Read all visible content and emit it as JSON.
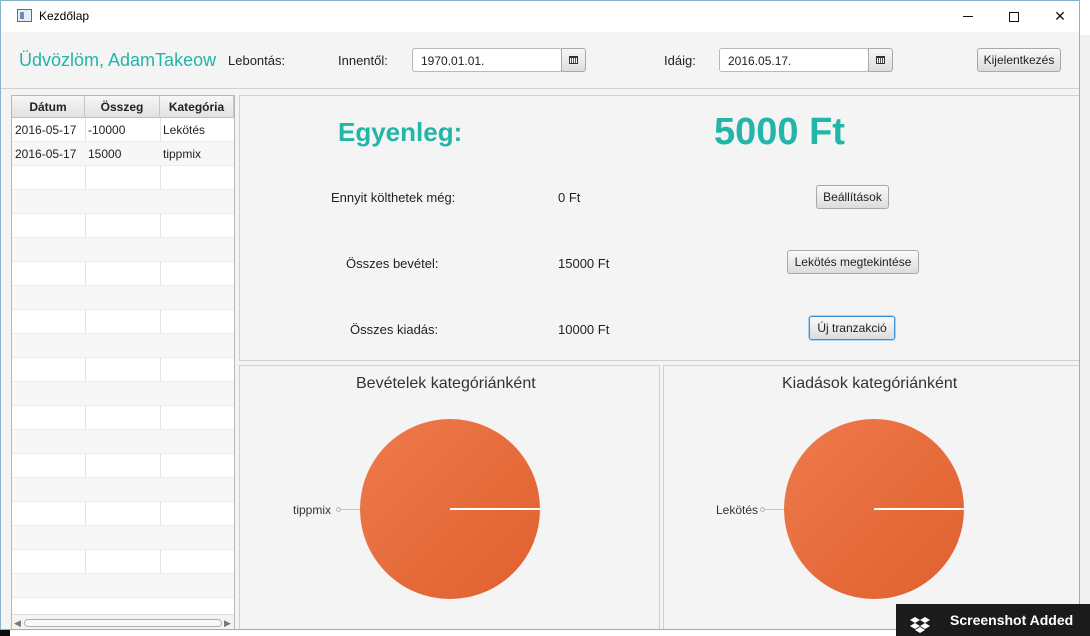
{
  "window": {
    "title": "Kezdőlap"
  },
  "topbar": {
    "welcome": "Üdvözlöm, AdamTakeow",
    "breakdown_label": "Lebontás:",
    "from_label": "Innentől:",
    "from_value": "1970.01.01.",
    "to_label": "Idáig:",
    "to_value": "2016.05.17.",
    "logout": "Kijelentkezés"
  },
  "table": {
    "headers": [
      "Dátum",
      "Összeg",
      "Kategória"
    ],
    "rows": [
      [
        "2016-05-17",
        "-10000",
        "Lekötés"
      ],
      [
        "2016-05-17",
        "15000",
        "tippmix"
      ]
    ]
  },
  "summary": {
    "balance_label": "Egyenleg:",
    "balance_value": "5000 Ft",
    "spendable_label": "Ennyit költhetek még:",
    "spendable_value": "0 Ft",
    "income_label": "Összes bevétel:",
    "income_value": "15000 Ft",
    "expense_label": "Összes kiadás:",
    "expense_value": "10000 Ft",
    "settings_button": "Beállítások",
    "lock_button": "Lekötés megtekintése",
    "new_button": "Új tranzakció"
  },
  "chart_data": [
    {
      "type": "pie",
      "title": "Bevételek kategóriánként",
      "categories": [
        "tippmix"
      ],
      "values": [
        15000
      ]
    },
    {
      "type": "pie",
      "title": "Kiadások kategóriánként",
      "categories": [
        "Lekötés"
      ],
      "values": [
        10000
      ]
    }
  ],
  "toast": {
    "text": "Screenshot Added"
  },
  "colors": {
    "accent": "#23b5a7",
    "pie": "#e0602e"
  }
}
